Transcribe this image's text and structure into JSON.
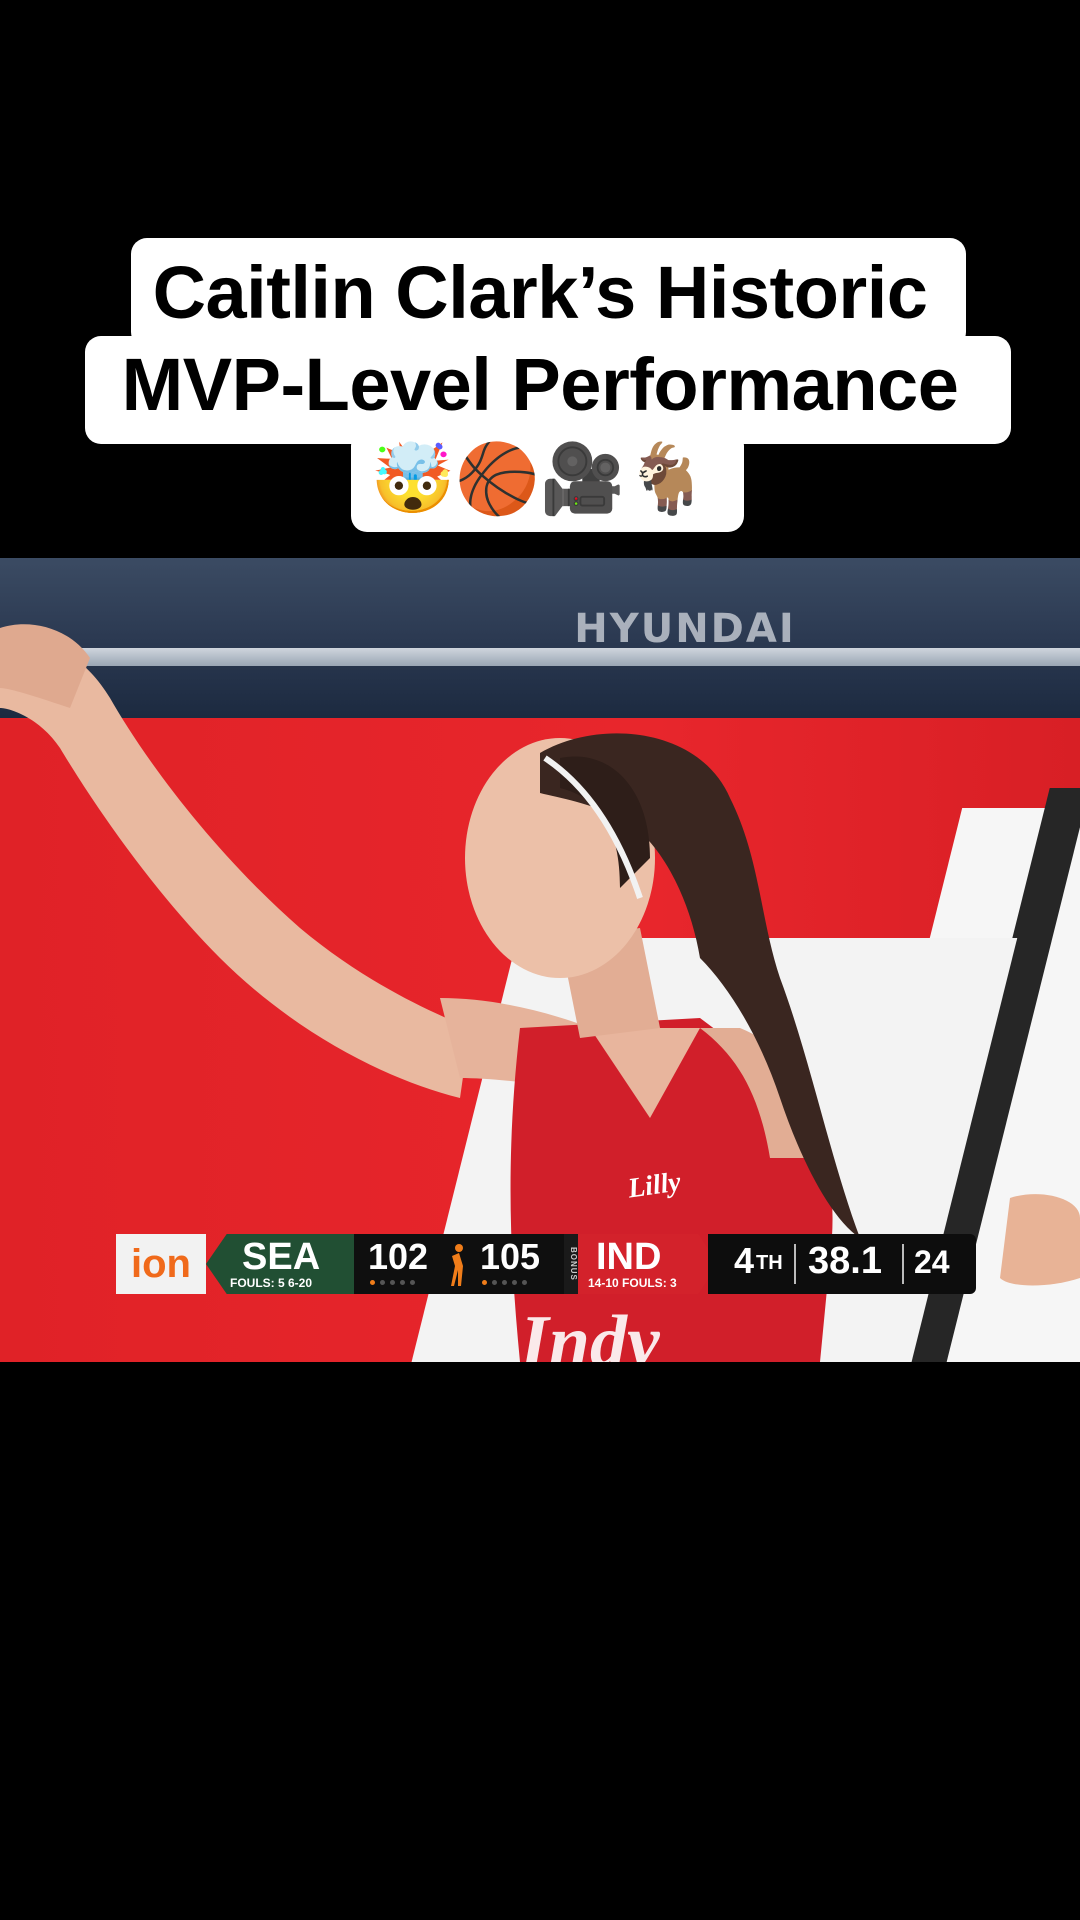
{
  "caption": {
    "line1": "Caitlin Clark’s Historic",
    "line2": "MVP-Level Performance",
    "emoji": "🤯🏀🎥🐐"
  },
  "video": {
    "sponsor_sign": "HYUNDAI",
    "jersey_patch": "Lilly",
    "jersey_text": "Indy"
  },
  "scorebug": {
    "network": "ion",
    "away": {
      "abbr": "SEA",
      "sub": "FOULS: 5  6-20",
      "score": "102",
      "color": "#214f33",
      "timeouts_lit": 1
    },
    "home": {
      "abbr": "IND",
      "sub": "14-10 FOULS: 3",
      "score": "105",
      "color": "#d3222b",
      "timeouts_lit": 1
    },
    "bonus_label": "BONUS",
    "quarter": "4",
    "quarter_suffix": "TH",
    "game_clock": "38.1",
    "shot_clock": "24"
  },
  "colors": {
    "background": "#000000",
    "caption_box": "#ffffff",
    "court_red": "#e21d26",
    "network_orange": "#f06a1b"
  }
}
